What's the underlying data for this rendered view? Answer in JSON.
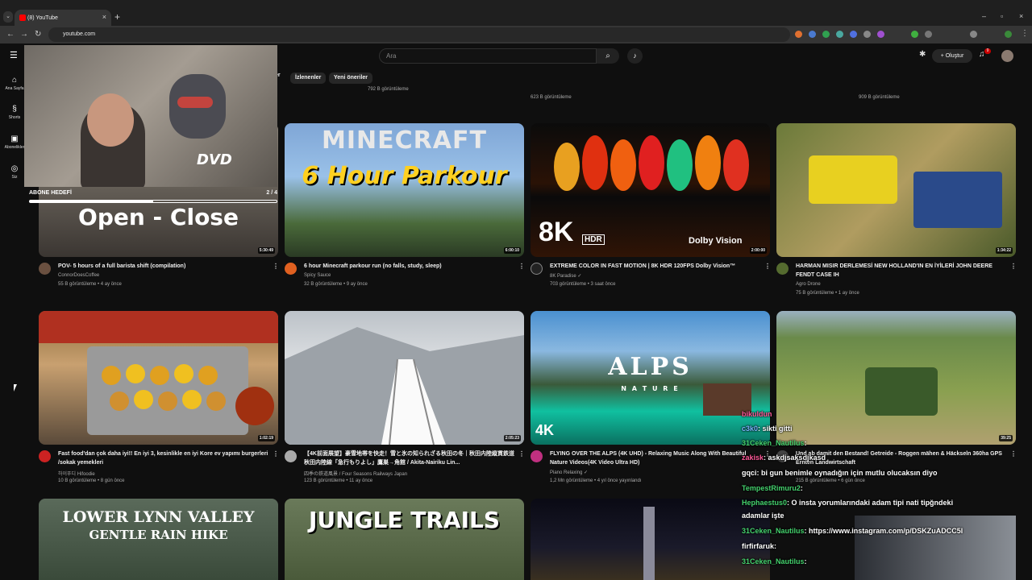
{
  "browser": {
    "tab_title": "(8) YouTube",
    "url": "youtube.com",
    "new_tab": "+",
    "tab_close": "×",
    "tab_menu": "⌄",
    "win_min": "–",
    "win_max": "▫",
    "win_close": "×"
  },
  "youtube": {
    "search_placeholder": "Ara",
    "create_label": "+ Oluştur",
    "notification_count": "9",
    "chips": [
      "İzlenenler",
      "Yeni öneriler"
    ],
    "chip_partial": "er"
  },
  "sidebar": [
    {
      "icon": "⌂",
      "label": "Ana Sayfa"
    },
    {
      "icon": "§",
      "label": "Shorts"
    },
    {
      "icon": "▣",
      "label": "Abonelikler"
    },
    {
      "icon": "◎",
      "label": "Siz"
    }
  ],
  "partial_row": [
    "792 B görüntüleme",
    "623 B görüntüleme",
    "909 B görüntüleme"
  ],
  "overlay": {
    "text": "ABONE HEDEFİ",
    "count": "2 / 4",
    "progress": 0.5,
    "webcam_logo": "DVD"
  },
  "videos": [
    {
      "title": "POV- 5 hours of a full barista shift (compilation)",
      "channel": "ConnorDoesCoffee",
      "meta": "55 B görüntüleme • 4 ay önce",
      "duration": "5:30:49",
      "thumb_text": "Open - Close",
      "avatar_color": "#6a5040"
    },
    {
      "title": "6 hour Minecraft parkour run (no falls, study, sleep)",
      "channel": "Spicy Sauce",
      "meta": "32 B görüntüleme • 9 ay önce",
      "duration": "6:00:10",
      "thumb_text": "MINECRAFT",
      "thumb_text2": "6 Hour Parkour",
      "avatar_color": "#e06020"
    },
    {
      "title": "EXTREME COLOR IN FAST MOTION | 8K HDR 120FPS Dolby Vision™",
      "channel": "8K Paradise ✓",
      "meta": "703 görüntüleme • 3 saat önce",
      "duration": "2:00:00",
      "thumb_text": "8K",
      "thumb_text2": "HDR",
      "thumb_text3": "Dolby Vision",
      "avatar_color": "#222222"
    },
    {
      "title": "HARMAN MISIR DERLEMESİ NEW HOLLAND'IN EN İYİLERİ JOHN DEERE FENDT CASE IH",
      "channel": "Agro Drone",
      "meta": "75 B görüntüleme • 1 ay önce",
      "duration": "1:34:22",
      "avatar_color": "#556b2f"
    },
    {
      "title": "Fast food'dan çok daha iyi!! En iyi 3, kesinlikle en iyi Kore ev yapımı burgerleri /sokak yemekleri",
      "channel": "하이푸디 Hifoodie",
      "meta": "10 B görüntüleme • 8 gün önce",
      "duration": "1:02:19",
      "avatar_color": "#cc2222"
    },
    {
      "title": "【4K前面展望】豪雪地帯を快走！雪と氷の知られざる秋田の冬｜秋田内陸縦貫鉄道 秋田内陸線「急行もりよし」鷹巣→角館 / Akita-Nairiku Lin...",
      "channel": "四季の鉄道風景 / Four Seasons Railways Japan",
      "meta": "123 B görüntüleme • 11 ay önce",
      "duration": "2:05:23",
      "avatar_color": "#aaaaaa"
    },
    {
      "title": "FLYING OVER THE ALPS (4K UHD) - Relaxing Music Along With Beautiful Nature Videos(4K Video Ultra HD)",
      "channel": "Piano Relaxing ✓",
      "meta": "1,2 Mn görüntüleme • 4 yıl önce yayınlandı",
      "duration": "",
      "thumb_text": "ALPS",
      "thumb_text2": "N A T U R E",
      "thumb_text3": "4K",
      "avatar_color": "#c03080"
    },
    {
      "title": "Und ab damit den Bestand! Getreide - Roggen mähen & Häckseln 360ha GPS Ernten Landwirtschaft",
      "channel": "",
      "meta": "215 B görüntüleme • 6 gün önce",
      "duration": "39:25",
      "avatar_color": "#444444"
    },
    {
      "thumb_text": "LOWER LYNN VALLEY",
      "thumb_text2": "GENTLE RAIN HIKE"
    },
    {
      "thumb_text": "JUNGLE TRAILS"
    }
  ],
  "chat": [
    {
      "user": "bikuldun",
      "msg": "",
      "color": "pink"
    },
    {
      "user": "c3k0",
      "msg": ": sikti gitti",
      "color": "blue"
    },
    {
      "user": "31Ceken_Nautilus",
      "msg": ":",
      "color": "green"
    },
    {
      "user": "zakisk",
      "msg": ": askdjsaksdjkasd",
      "color": "pink"
    },
    {
      "user": "gqci",
      "msg": ": bi gun benimle oynadığın için mutlu olucaksın diyo",
      "color": "white"
    },
    {
      "user": "TempestRimuru2",
      "msg": ":",
      "color": "green"
    },
    {
      "user": "Hephaestus0",
      "msg": ": O insta yorumlarındaki adam tipi nati tipğndeki",
      "color": "green"
    },
    {
      "user": "",
      "msg": "adamlar işte",
      "color": "white"
    },
    {
      "user": "31Ceken_Nautilus",
      "msg": ": https://www.instagram.com/p/DSKZuADCC5l",
      "color": "green"
    },
    {
      "user": "firfirfaruk",
      "msg": ":",
      "color": "white"
    },
    {
      "user": "31Ceken_Nautilus",
      "msg": ":",
      "color": "green"
    }
  ]
}
